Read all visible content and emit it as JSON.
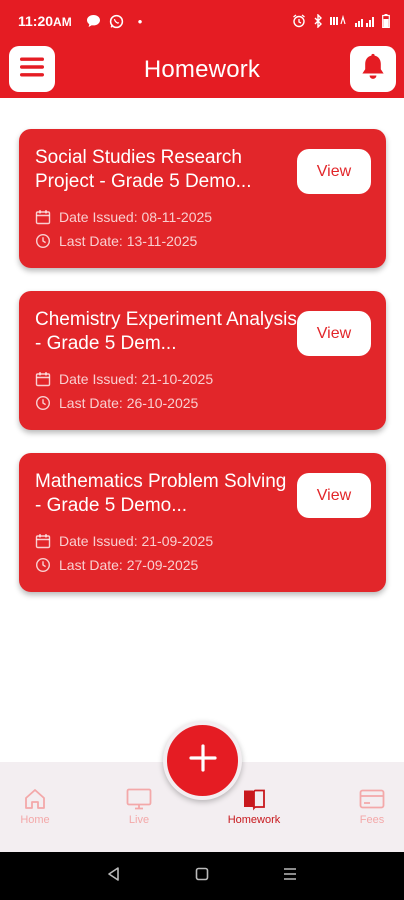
{
  "status_bar": {
    "time": "11:20",
    "ampm": "AM",
    "dot": "•"
  },
  "header": {
    "title": "Homework"
  },
  "homework": [
    {
      "title": "Social Studies Research Project - Grade 5 Demo...",
      "view_label": "View",
      "issued_label": "Date Issued: 08-11-2025",
      "due_label": "Last Date: 13-11-2025"
    },
    {
      "title": "Chemistry Experiment Analysis - Grade 5 Dem...",
      "view_label": "View",
      "issued_label": "Date Issued: 21-10-2025",
      "due_label": "Last Date: 26-10-2025"
    },
    {
      "title": "Mathematics Problem Solving - Grade 5 Demo...",
      "view_label": "View",
      "issued_label": "Date Issued: 21-09-2025",
      "due_label": "Last Date: 27-09-2025"
    }
  ],
  "fab": {
    "icon": "plus-icon"
  },
  "bottom_nav": [
    {
      "label": "Home",
      "icon": "home-icon",
      "active": false
    },
    {
      "label": "Live",
      "icon": "monitor-icon",
      "active": false
    },
    {
      "label": "Homework",
      "icon": "book-icon",
      "active": true
    },
    {
      "label": "Fees",
      "icon": "card-icon",
      "active": false
    }
  ],
  "colors": {
    "primary": "#e51c23",
    "card": "#e2262a",
    "nav_bg": "#f3eef1",
    "nav_inactive": "#f3a8a9",
    "nav_active": "#c8181d"
  }
}
